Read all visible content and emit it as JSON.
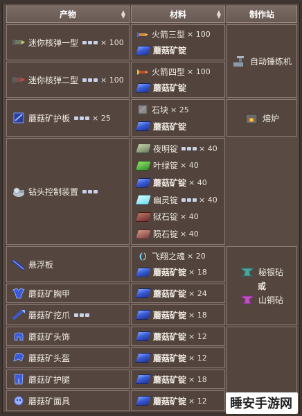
{
  "headers": {
    "product": "产物",
    "materials": "材料",
    "station": "制作站"
  },
  "rows": [
    {
      "product": "迷你核弹一型",
      "product_count": "× 100",
      "materials": [
        {
          "name": "火箭三型",
          "count": "× 100"
        },
        {
          "name": "蘑菇矿锭",
          "count": ""
        }
      ]
    },
    {
      "product": "迷你核弹二型",
      "product_count": "× 100",
      "materials": [
        {
          "name": "火箭四型",
          "count": "× 100"
        },
        {
          "name": "蘑菇矿锭",
          "count": ""
        }
      ]
    },
    {
      "product": "蘑菇矿护板",
      "product_count": "× 25",
      "materials": [
        {
          "name": "石块",
          "count": "× 25"
        },
        {
          "name": "蘑菇矿锭",
          "count": ""
        }
      ]
    },
    {
      "product": "钻头控制装置",
      "product_count": "",
      "materials": [
        {
          "name": "夜明锭",
          "count": "× 40"
        },
        {
          "name": "叶绿锭",
          "count": "× 40"
        },
        {
          "name": "蘑菇矿锭",
          "count": "× 40"
        },
        {
          "name": "幽灵锭",
          "count": "× 40"
        },
        {
          "name": "狱石锭",
          "count": "× 40"
        },
        {
          "name": "陨石锭",
          "count": "× 40"
        }
      ]
    },
    {
      "product": "悬浮板",
      "product_count": "",
      "materials": [
        {
          "name": "飞翔之魂",
          "count": "× 20"
        },
        {
          "name": "蘑菇矿锭",
          "count": "× 18"
        }
      ]
    },
    {
      "product": "蘑菇矿胸甲",
      "product_count": "",
      "materials": [
        {
          "name": "蘑菇矿锭",
          "count": "× 24"
        }
      ]
    },
    {
      "product": "蘑菇矿挖爪",
      "product_count": "",
      "materials": [
        {
          "name": "蘑菇矿锭",
          "count": "× 18"
        }
      ]
    },
    {
      "product": "蘑菇矿头饰",
      "product_count": "",
      "materials": [
        {
          "name": "蘑菇矿锭",
          "count": "× 12"
        }
      ]
    },
    {
      "product": "蘑菇矿头盔",
      "product_count": "",
      "materials": [
        {
          "name": "蘑菇矿锭",
          "count": "× 12"
        }
      ]
    },
    {
      "product": "蘑菇矿护腿",
      "product_count": "",
      "materials": [
        {
          "name": "蘑菇矿锭",
          "count": "× 18"
        }
      ]
    },
    {
      "product": "蘑菇矿面具",
      "product_count": "",
      "materials": [
        {
          "name": "蘑菇矿锭",
          "count": "× 12"
        }
      ]
    }
  ],
  "stations": {
    "autohammer": "自动锤炼机",
    "furnace": "熔炉",
    "mythril_anvil": "秘银砧",
    "or": "或",
    "orichalcum_anvil": "山铜砧"
  },
  "watermark": "睡安手游网",
  "colors": {
    "ingot": "#3a5cd8",
    "header": "#7a6a64",
    "background": "#3f3531"
  }
}
